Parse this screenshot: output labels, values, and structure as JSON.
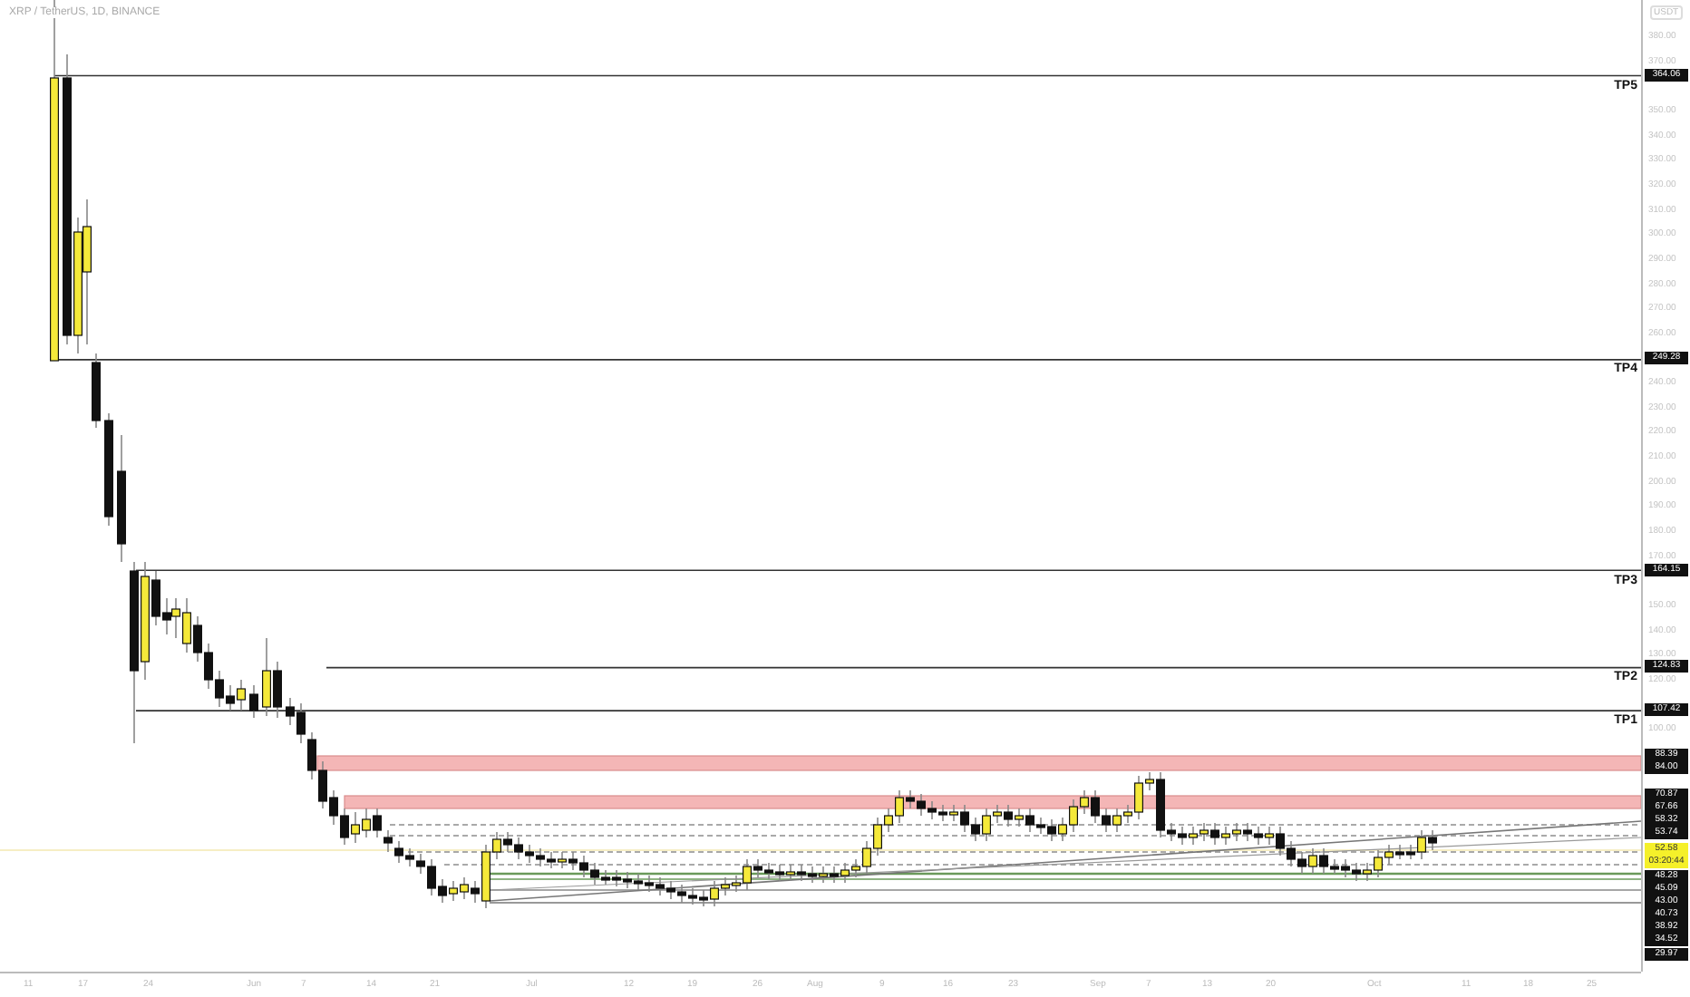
{
  "symbol_title": "XRP / TetherUS, 1D, BINANCE",
  "price_axis": {
    "unit": "USDT",
    "ticks": [
      "380.00",
      "370.00",
      "350.00",
      "340.00",
      "330.00",
      "320.00",
      "310.00",
      "300.00",
      "290.00",
      "280.00",
      "270.00",
      "260.00",
      "240.00",
      "230.00",
      "220.00",
      "210.00",
      "200.00",
      "190.00",
      "180.00",
      "170.00",
      "150.00",
      "140.00",
      "130.00",
      "120.00",
      "100.00"
    ]
  },
  "targets": [
    {
      "label": "TP5",
      "price": "364.06"
    },
    {
      "label": "TP4",
      "price": "249.28"
    },
    {
      "label": "TP3",
      "price": "164.15"
    },
    {
      "label": "TP2",
      "price": "124.83"
    },
    {
      "label": "TP1",
      "price": "107.42"
    }
  ],
  "level_labels": [
    {
      "text": "88.39",
      "kind": "level"
    },
    {
      "text": "84.00",
      "kind": "level"
    },
    {
      "text": "70.87",
      "kind": "level"
    },
    {
      "text": "67.66",
      "kind": "level"
    },
    {
      "text": "58.32",
      "kind": "level"
    },
    {
      "text": "53.74",
      "kind": "level"
    },
    {
      "text": "52.58",
      "kind": "current"
    },
    {
      "text": "03:20:44",
      "kind": "current"
    },
    {
      "text": "48.28",
      "kind": "level"
    },
    {
      "text": "45.09",
      "kind": "level"
    },
    {
      "text": "43.00",
      "kind": "level"
    },
    {
      "text": "40.73",
      "kind": "level"
    },
    {
      "text": "38.92",
      "kind": "level"
    },
    {
      "text": "34.52",
      "kind": "level"
    },
    {
      "text": "29.97",
      "kind": "level"
    }
  ],
  "time_axis": {
    "ticks": [
      "11",
      "17",
      "24",
      "Jun",
      "7",
      "14",
      "21",
      "Jul",
      "12",
      "19",
      "26",
      "Aug",
      "9",
      "16",
      "23",
      "Sep",
      "7",
      "13",
      "20",
      "Oct",
      "11",
      "18",
      "25"
    ]
  }
}
